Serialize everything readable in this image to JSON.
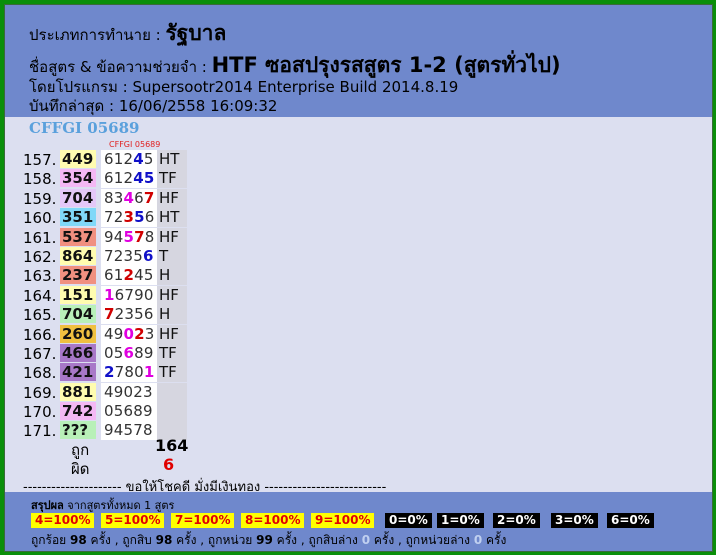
{
  "header": {
    "type_label": "ประเภทการทำนาย : ",
    "type_value": "รัฐบาล",
    "formula_label": "ชื่อสูตร & ข้อความช่วยจำ : ",
    "formula_value": "HTF ซอสปรุงรสสูตร 1-2 (สูตรทั่วไป)",
    "program": "โดยโปรแกรม : Supersootr2014 Enterprise Build 2014.8.19",
    "saved": "บันทึกล่าสุด : 16/06/2558 16:09:32"
  },
  "code_title": "CFFGI 05689",
  "code_small": "CFFGI 05689",
  "colors": {
    "yellow": "#fffcb0",
    "pink": "#f4b8f4",
    "lilac": "#e4c8f8",
    "cyan": "#80d8f8",
    "salmon": "#f09080",
    "green": "#b8f0b8",
    "purple": "#a878c8"
  },
  "rows": [
    {
      "idx": "157.",
      "pred": "449",
      "bg": "#fffcb0",
      "digits": [
        [
          "6",
          ""
        ],
        [
          "1",
          ""
        ],
        [
          "2",
          ""
        ],
        [
          "4",
          "b"
        ],
        [
          "5",
          ""
        ]
      ],
      "tag": "HT"
    },
    {
      "idx": "158.",
      "pred": "354",
      "bg": "#f4b8f4",
      "digits": [
        [
          "6",
          ""
        ],
        [
          "1",
          ""
        ],
        [
          "2",
          ""
        ],
        [
          "4",
          "b"
        ],
        [
          "5",
          "b"
        ]
      ],
      "tag": "TF"
    },
    {
      "idx": "159.",
      "pred": "704",
      "bg": "#e4c8f8",
      "digits": [
        [
          "8",
          ""
        ],
        [
          "3",
          ""
        ],
        [
          "4",
          "m"
        ],
        [
          "6",
          ""
        ],
        [
          "7",
          "r"
        ]
      ],
      "tag": "HF"
    },
    {
      "idx": "160.",
      "pred": "351",
      "bg": "#80d8f8",
      "digits": [
        [
          "7",
          ""
        ],
        [
          "2",
          ""
        ],
        [
          "3",
          "r"
        ],
        [
          "5",
          "b"
        ],
        [
          "6",
          ""
        ]
      ],
      "tag": "HT"
    },
    {
      "idx": "161.",
      "pred": "537",
      "bg": "#f09080",
      "digits": [
        [
          "9",
          ""
        ],
        [
          "4",
          ""
        ],
        [
          "5",
          "m"
        ],
        [
          "7",
          "r"
        ],
        [
          "8",
          ""
        ]
      ],
      "tag": "HF"
    },
    {
      "idx": "162.",
      "pred": "864",
      "bg": "#fffcb0",
      "digits": [
        [
          "7",
          ""
        ],
        [
          "2",
          ""
        ],
        [
          "3",
          ""
        ],
        [
          "5",
          ""
        ],
        [
          "6",
          "b"
        ]
      ],
      "tag": "T"
    },
    {
      "idx": "163.",
      "pred": "237",
      "bg": "#f09080",
      "digits": [
        [
          "6",
          ""
        ],
        [
          "1",
          ""
        ],
        [
          "2",
          "r"
        ],
        [
          "4",
          ""
        ],
        [
          "5",
          ""
        ]
      ],
      "tag": "H"
    },
    {
      "idx": "164.",
      "pred": "151",
      "bg": "#fffcb0",
      "digits": [
        [
          "1",
          "m"
        ],
        [
          "6",
          ""
        ],
        [
          "7",
          ""
        ],
        [
          "9",
          ""
        ],
        [
          "0",
          ""
        ]
      ],
      "tag": "HF"
    },
    {
      "idx": "165.",
      "pred": "704",
      "bg": "#b8f0b8",
      "digits": [
        [
          "7",
          "r"
        ],
        [
          "2",
          ""
        ],
        [
          "3",
          ""
        ],
        [
          "5",
          ""
        ],
        [
          "6",
          ""
        ]
      ],
      "tag": "H"
    },
    {
      "idx": "166.",
      "pred": "260",
      "bg": "#f0c040",
      "digits": [
        [
          "4",
          ""
        ],
        [
          "9",
          ""
        ],
        [
          "0",
          "m"
        ],
        [
          "2",
          "r"
        ],
        [
          "3",
          ""
        ]
      ],
      "tag": "HF"
    },
    {
      "idx": "167.",
      "pred": "466",
      "bg": "#a878c8",
      "digits": [
        [
          "0",
          ""
        ],
        [
          "5",
          ""
        ],
        [
          "6",
          "m"
        ],
        [
          "8",
          ""
        ],
        [
          "9",
          ""
        ]
      ],
      "tag": "TF"
    },
    {
      "idx": "168.",
      "pred": "421",
      "bg": "#a878c8",
      "digits": [
        [
          "2",
          "b"
        ],
        [
          "7",
          ""
        ],
        [
          "8",
          ""
        ],
        [
          "0",
          ""
        ],
        [
          "1",
          "m"
        ]
      ],
      "tag": "TF"
    },
    {
      "idx": "169.",
      "pred": "881",
      "bg": "#fffcb0",
      "digits": [
        [
          "4",
          ""
        ],
        [
          "9",
          ""
        ],
        [
          "0",
          ""
        ],
        [
          "2",
          ""
        ],
        [
          "3",
          ""
        ]
      ],
      "tag": ""
    },
    {
      "idx": "170.",
      "pred": "742",
      "bg": "#f4b8f4",
      "digits": [
        [
          "0",
          ""
        ],
        [
          "5",
          ""
        ],
        [
          "6",
          ""
        ],
        [
          "8",
          ""
        ],
        [
          "9",
          ""
        ]
      ],
      "tag": ""
    },
    {
      "idx": "171.",
      "pred": "???",
      "bg": "#b8f0b8",
      "digits": [
        [
          "9",
          ""
        ],
        [
          "4",
          ""
        ],
        [
          "5",
          ""
        ],
        [
          "7",
          ""
        ],
        [
          "8",
          ""
        ]
      ],
      "tag": ""
    }
  ],
  "summary": {
    "correct_label": "ถูก",
    "correct_value": "164",
    "wrong_label": "ผิด",
    "wrong_value": "6"
  },
  "divider": "--------------------- ขอให้โชคดี มั่งมีเงินทอง --------------------------",
  "footer": {
    "title_bold": "สรุปผล",
    "title_rest": " จากสูตรทั้งหมด 1 สูตร",
    "badges_yellow": [
      "4=100%",
      "5=100%",
      "7=100%",
      "8=100%",
      "9=100%"
    ],
    "badges_black": [
      "0=0%",
      "1=0%",
      "2=0%",
      "3=0%",
      "6=0%"
    ],
    "stats": [
      {
        "label": "ถูกร้อย ",
        "value": "98",
        "suffix": " ครั้ง , "
      },
      {
        "label": "ถูกสิบ ",
        "value": "98",
        "suffix": " ครั้ง , "
      },
      {
        "label": "ถูกหน่วย ",
        "value": "99",
        "suffix": " ครั้ง , "
      },
      {
        "label": "ถูกสิบล่าง ",
        "value": "0",
        "suffix": " ครั้ง , "
      },
      {
        "label": "ถูกหน่วยล่าง ",
        "value": "0",
        "suffix": " ครั้ง"
      }
    ]
  }
}
